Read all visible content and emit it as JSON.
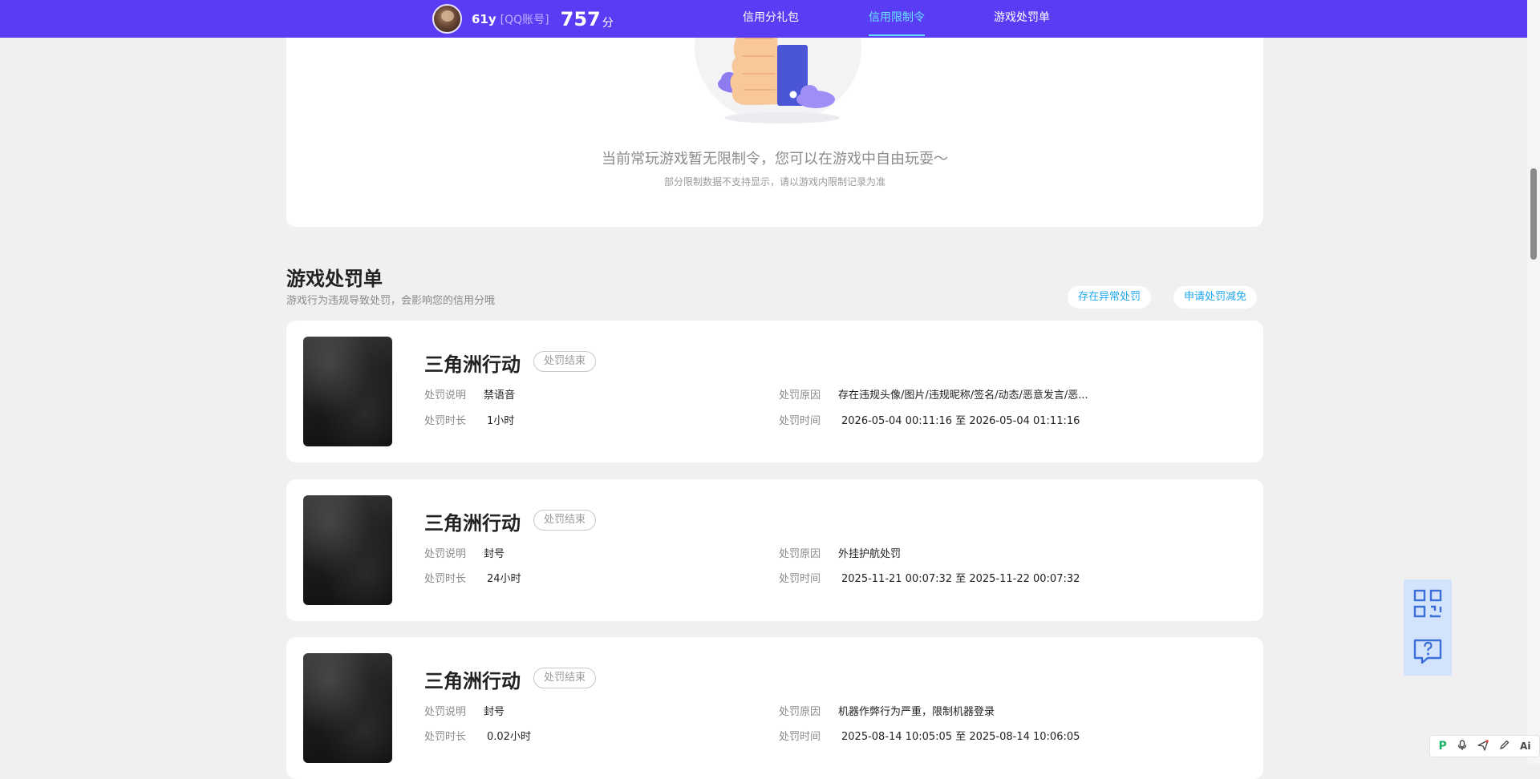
{
  "header": {
    "username": "61y",
    "account_type": "[QQ账号]",
    "score": "757",
    "score_unit": "分",
    "nav": [
      {
        "label": "信用分礼包",
        "active": false
      },
      {
        "label": "信用限制令",
        "active": true
      },
      {
        "label": "游戏处罚单",
        "active": false
      }
    ]
  },
  "restriction": {
    "empty_title": "当前常玩游戏暂无限制令，您可以在游戏中自由玩耍～",
    "empty_subtitle": "部分限制数据不支持显示，请以游戏内限制记录为准"
  },
  "penalty_section": {
    "title": "游戏处罚单",
    "description": "游戏行为违规导致处罚，会影响您的信用分哦",
    "buttons": {
      "abnormal": "存在异常处罚",
      "appeal": "申请处罚减免"
    },
    "labels": {
      "desc": "处罚说明",
      "duration": "处罚时长",
      "reason": "处罚原因",
      "time": "处罚时间"
    },
    "records": [
      {
        "game": "三角洲行动",
        "status": "处罚结束",
        "desc": "禁语音",
        "duration": "1小时",
        "reason": "存在违规头像/图片/违规昵称/签名/动态/恶意发言/恶...",
        "time": "2026-05-04 00:11:16 至 2026-05-04 01:11:16"
      },
      {
        "game": "三角洲行动",
        "status": "处罚结束",
        "desc": "封号",
        "duration": "24小时",
        "reason": "外挂护航处罚",
        "time": "2025-11-21 00:07:32 至 2025-11-22 00:07:32"
      },
      {
        "game": "三角洲行动",
        "status": "处罚结束",
        "desc": "封号",
        "duration": "0.02小时",
        "reason": "机器作弊行为严重，限制机器登录",
        "time": "2025-08-14 10:05:05 至 2025-08-14 10:06:05"
      }
    ]
  },
  "floating": {
    "icons": [
      "qrcode-icon",
      "help-chat-icon"
    ]
  },
  "toolbar": {
    "ai_label": "Ai"
  }
}
